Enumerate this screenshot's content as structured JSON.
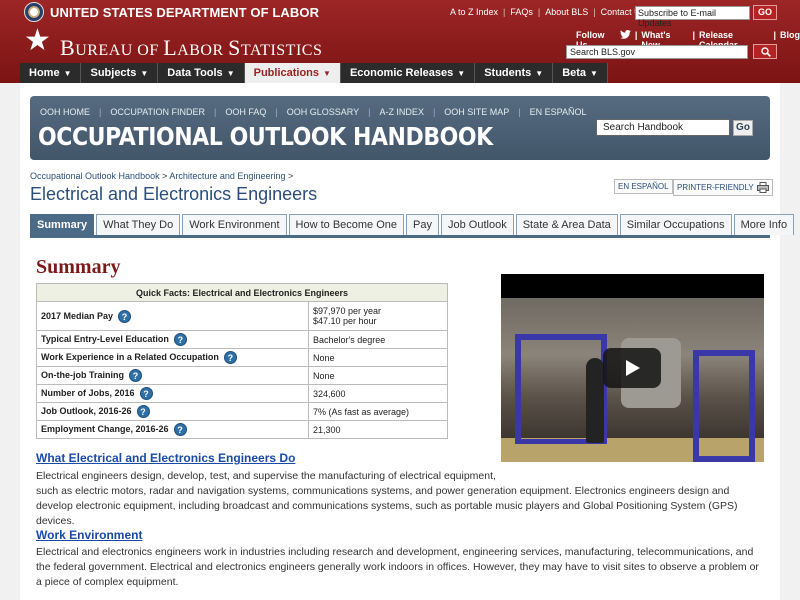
{
  "header": {
    "dol_title": "UNITED STATES DEPARTMENT OF LABOR",
    "top_links": [
      "A to Z Index",
      "FAQs",
      "About BLS",
      "Contact Us"
    ],
    "email_input_value": "Subscribe to E-mail Updates",
    "go_label": "GO",
    "bls_title_B": "B",
    "bls_title_rest1": "UREAU OF ",
    "bls_title_L": "L",
    "bls_title_rest2": "ABOR ",
    "bls_title_S": "S",
    "bls_title_rest3": "TATISTICS",
    "follow_us": "Follow Us",
    "follow_links": [
      "What's New",
      "Release Calendar",
      "Blog"
    ],
    "search_value": "Search BLS.gov"
  },
  "nav": {
    "items": [
      "Home",
      "Subjects",
      "Data Tools",
      "Publications",
      "Economic Releases",
      "Students",
      "Beta"
    ],
    "active": "Publications"
  },
  "ooh": {
    "links": [
      "OOH HOME",
      "OCCUPATION FINDER",
      "OOH FAQ",
      "OOH GLOSSARY",
      "A-Z INDEX",
      "OOH SITE MAP",
      "EN ESPAÑOL"
    ],
    "title": "OCCUPATIONAL OUTLOOK HANDBOOK",
    "search_value": "Search Handbook",
    "go_label": "Go"
  },
  "breadcrumb": {
    "item1": "Occupational Outlook Handbook",
    "item2": "Architecture and Engineering",
    "sep": ">"
  },
  "page": {
    "title": "Electrical and Electronics Engineers",
    "espanol_label": "EN ESPAÑOL",
    "print_label": "PRINTER-FRIENDLY"
  },
  "tabs": {
    "items": [
      "Summary",
      "What They Do",
      "Work Environment",
      "How to Become One",
      "Pay",
      "Job Outlook",
      "State & Area Data",
      "Similar Occupations",
      "More Info"
    ],
    "active": "Summary"
  },
  "summary": {
    "heading": "Summary",
    "quick_facts_title": "Quick Facts: Electrical and Electronics Engineers",
    "rows": [
      {
        "label": "2017 Median Pay",
        "value": "$97,970 per year",
        "value2": "$47.10 per hour"
      },
      {
        "label": "Typical Entry-Level Education",
        "value": "Bachelor's degree"
      },
      {
        "label": "Work Experience in a Related Occupation",
        "value": "None"
      },
      {
        "label": "On-the-job Training",
        "value": "None"
      },
      {
        "label": "Number of Jobs, 2016",
        "value": "324,600"
      },
      {
        "label": "Job Outlook, 2016-26",
        "value": "7% (As fast as average)"
      },
      {
        "label": "Employment Change, 2016-26",
        "value": "21,300"
      }
    ],
    "info_glyph": "?"
  },
  "sections": [
    {
      "heading": "What Electrical and Electronics Engineers Do",
      "line1": "Electrical engineers design, develop, test, and supervise the manufacturing of electrical equipment,",
      "line2": "such as electric motors, radar and navigation systems, communications systems, and power generation equipment. Electronics engineers design and develop electronic equipment, including broadcast and communications systems, such as portable music players and Global Positioning System (GPS) devices."
    },
    {
      "heading": "Work Environment",
      "line1": "Electrical and electronics engineers work in industries including research and development, engineering services, manufacturing, telecommunications, and the federal government. Electrical and electronics engineers generally work indoors in offices. However, they may have to visit sites to observe a problem or a piece of complex equipment."
    }
  ]
}
